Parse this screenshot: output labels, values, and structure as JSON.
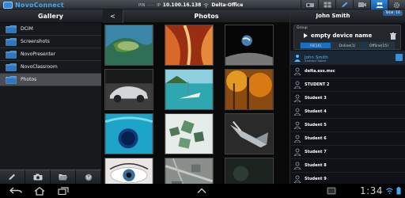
{
  "app": {
    "brand": "NovoConnect",
    "pin_label": "PIN",
    "pin_value": "-----",
    "ip_label": "IP",
    "ip_value": "10.100.16.138",
    "ssid_value": "Delta-Office"
  },
  "header": {
    "gallery_title": "Gallery",
    "back_label": "<",
    "photos_title": "Photos"
  },
  "sidebar": {
    "items": [
      {
        "label": "DCIM"
      },
      {
        "label": "Screenshots"
      },
      {
        "label": "NovoPresenter"
      },
      {
        "label": "NovoClassroom"
      },
      {
        "label": "Photos"
      }
    ],
    "selected_index": 4
  },
  "panel": {
    "user_name": "John Smith",
    "total": "Total: 16",
    "group_label": "Group",
    "group_name": "empty device name",
    "filters": [
      "All(16)",
      "Online(1)",
      "Offline(15)"
    ],
    "host": {
      "name": "John Smith",
      "device": "Android Tablet"
    },
    "users": [
      "delta.ess.msc",
      "STUDENT 2",
      "Student 3",
      "Student 4",
      "Student 5",
      "Student 6",
      "Student 7",
      "Student 8",
      "Student 9"
    ]
  },
  "photos": [
    "island-aerial",
    "red-rock-canyon",
    "earth-from-moon",
    "sports-car",
    "tropical-boat",
    "autumn-forest",
    "blue-hole",
    "green-crystals",
    "fish-sculpture",
    "eye-closeup",
    "city-aerial",
    "dark-photo"
  ],
  "status": {
    "clock": "1:34"
  },
  "colors": {
    "accent": "#3fa9f5",
    "selected": "#4a4e54",
    "panel": "#0f1116"
  }
}
